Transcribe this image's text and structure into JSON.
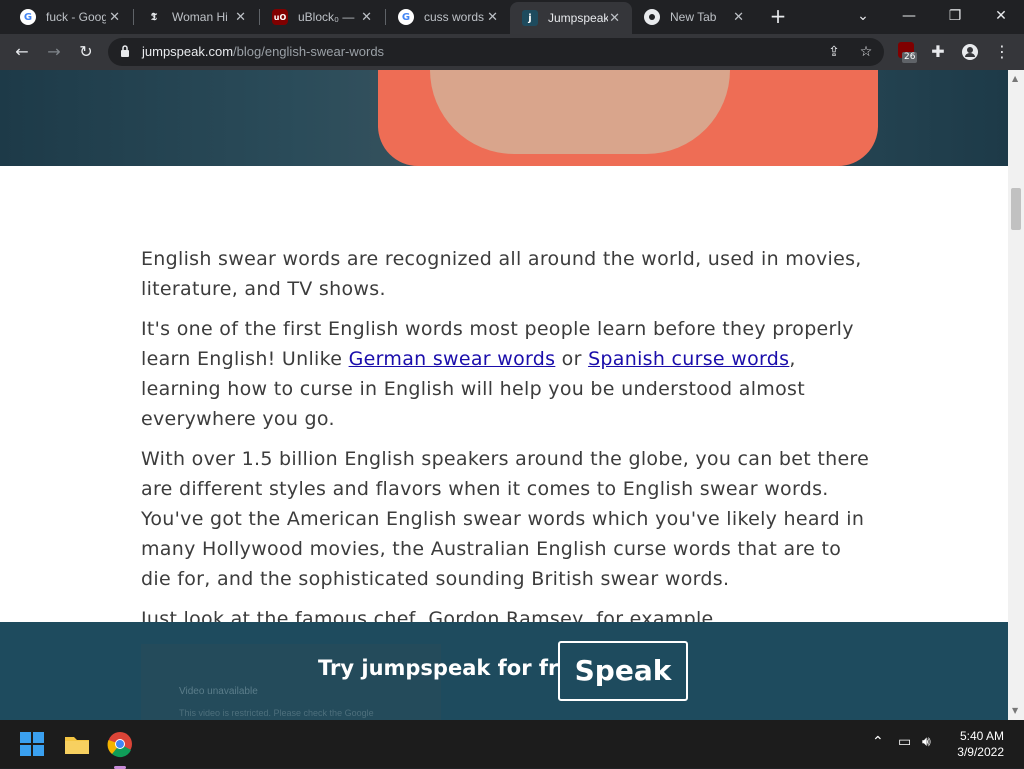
{
  "tabs": [
    {
      "title": "fuck - Google",
      "favicon": "google-icon",
      "active": false
    },
    {
      "title": "Woman Hi",
      "favicon": "nyt-icon",
      "active": false
    },
    {
      "title": "uBlock₀ —",
      "favicon": "ublock-icon",
      "active": false
    },
    {
      "title": "cuss words",
      "favicon": "google-icon",
      "active": false
    },
    {
      "title": "Jumpspeak",
      "favicon": "jumpspeak-icon",
      "active": true
    },
    {
      "title": "New Tab",
      "favicon": "chrome-icon",
      "active": false
    }
  ],
  "address": {
    "host": "jumpspeak.com",
    "path": "/blog/english-swear-words"
  },
  "extensions": {
    "ublock_badge": "26"
  },
  "article": {
    "p1": "English swear words are recognized all around the world, used in movies, literature, and TV shows.",
    "p2_before": "It's one of the first English words most people learn before they properly learn English! Unlike ",
    "p2_link1": "German swear words",
    "p2_mid": " or ",
    "p2_link2": "Spanish curse words",
    "p2_after": ", learning how to curse in English will help you be understood almost everywhere you go.",
    "p3": "With over 1.5 billion English speakers around the globe, you can bet there are different styles and flavors when it comes to English swear words. You've got the American English swear words which you've likely heard in many Hollywood movies, the Australian English curse words that are to die for, and the sophisticated sounding British swear words.",
    "p4": "Just look at the famous chef, Gordon Ramsey, for example."
  },
  "video": {
    "title": "Video unavailable",
    "subtitle": "This video is restricted. Please check the Google"
  },
  "cta": {
    "text": "Try jumpspeak for free.",
    "button": "Speak"
  },
  "clock": {
    "time": "5:40 AM",
    "date": "3/9/2022"
  },
  "colors": {
    "cta_bg": "#1e4b5e",
    "link": "#1a0dab",
    "accent_shirt": "#ee6d55"
  }
}
